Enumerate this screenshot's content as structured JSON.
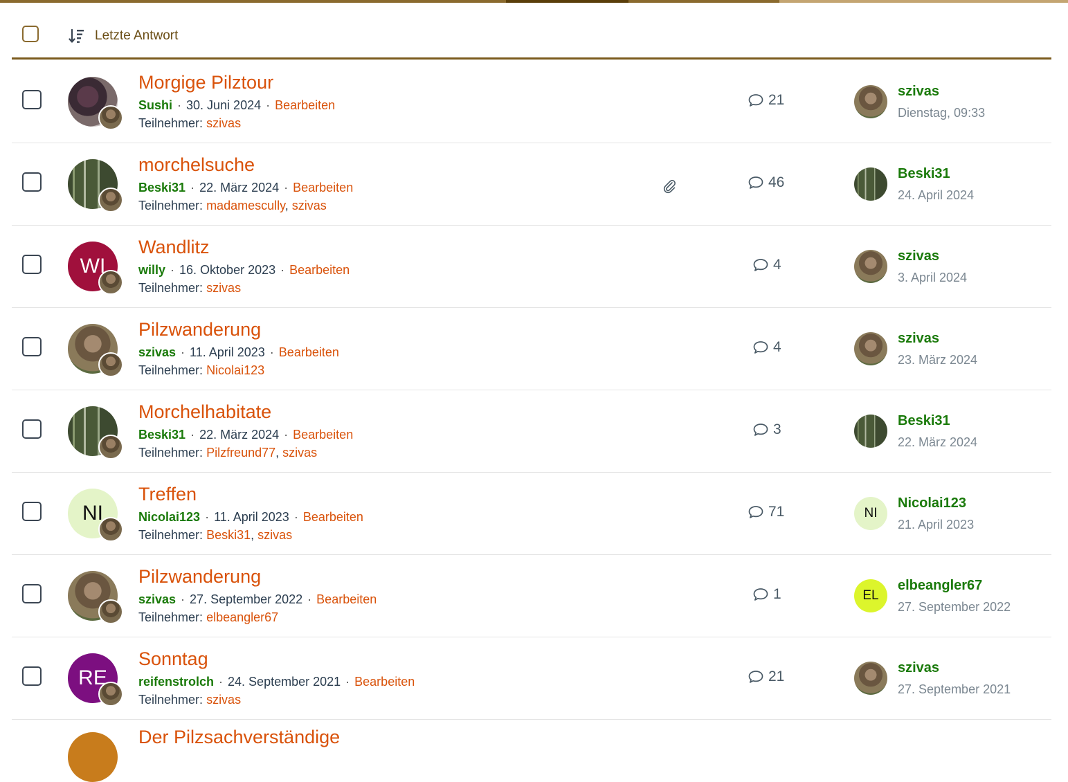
{
  "header": {
    "sort_label": "Letzte Antwort",
    "progress_colors": [
      "#8a6a2e",
      "#5a3e0a",
      "#8a6a2e",
      "#c4a572"
    ]
  },
  "rows": [
    {
      "title": "Morgige Pilztour",
      "author": "Sushi",
      "date": "30. Juni 2024",
      "edit_label": "Bearbeiten",
      "participants_label": "Teilnehmer:",
      "participants": [
        "szivas"
      ],
      "replies": "21",
      "attachment": false,
      "avatar_initials": "",
      "avatar_color": "",
      "last_poster": "szivas",
      "last_date": "Dienstag, 09:33",
      "last_avatar_initials": "",
      "last_avatar_color": ""
    },
    {
      "title": "morchelsuche",
      "author": "Beski31",
      "date": "22. März 2024",
      "edit_label": "Bearbeiten",
      "participants_label": "Teilnehmer:",
      "participants": [
        "madamescully",
        "szivas"
      ],
      "replies": "46",
      "attachment": true,
      "avatar_initials": "",
      "avatar_color": "",
      "last_poster": "Beski31",
      "last_date": "24. April 2024",
      "last_avatar_initials": "",
      "last_avatar_color": ""
    },
    {
      "title": "Wandlitz",
      "author": "willy",
      "date": "16. Oktober 2023",
      "edit_label": "Bearbeiten",
      "participants_label": "Teilnehmer:",
      "participants": [
        "szivas"
      ],
      "replies": "4",
      "attachment": false,
      "avatar_initials": "WI",
      "avatar_color": "#a0103c",
      "last_poster": "szivas",
      "last_date": "3. April 2024",
      "last_avatar_initials": "",
      "last_avatar_color": ""
    },
    {
      "title": "Pilzwanderung",
      "author": "szivas",
      "date": "11. April 2023",
      "edit_label": "Bearbeiten",
      "participants_label": "Teilnehmer:",
      "participants": [
        "Nicolai123"
      ],
      "replies": "4",
      "attachment": false,
      "avatar_initials": "",
      "avatar_color": "",
      "last_poster": "szivas",
      "last_date": "23. März 2024",
      "last_avatar_initials": "",
      "last_avatar_color": ""
    },
    {
      "title": "Morchelhabitate",
      "author": "Beski31",
      "date": "22. März 2024",
      "edit_label": "Bearbeiten",
      "participants_label": "Teilnehmer:",
      "participants": [
        "Pilzfreund77",
        "szivas"
      ],
      "replies": "3",
      "attachment": false,
      "avatar_initials": "",
      "avatar_color": "",
      "last_poster": "Beski31",
      "last_date": "22. März 2024",
      "last_avatar_initials": "",
      "last_avatar_color": ""
    },
    {
      "title": "Treffen",
      "author": "Nicolai123",
      "date": "11. April 2023",
      "edit_label": "Bearbeiten",
      "participants_label": "Teilnehmer:",
      "participants": [
        "Beski31",
        "szivas"
      ],
      "replies": "71",
      "attachment": false,
      "avatar_initials": "NI",
      "avatar_color": "#e4f4c8",
      "last_poster": "Nicolai123",
      "last_date": "21. April 2023",
      "last_avatar_initials": "NI",
      "last_avatar_color": "#e4f4c8"
    },
    {
      "title": "Pilzwanderung",
      "author": "szivas",
      "date": "27. September 2022",
      "edit_label": "Bearbeiten",
      "participants_label": "Teilnehmer:",
      "participants": [
        "elbeangler67"
      ],
      "replies": "1",
      "attachment": false,
      "avatar_initials": "",
      "avatar_color": "",
      "last_poster": "elbeangler67",
      "last_date": "27. September 2022",
      "last_avatar_initials": "EL",
      "last_avatar_color": "#dcf52c"
    },
    {
      "title": "Sonntag",
      "author": "reifenstrolch",
      "date": "24. September 2021",
      "edit_label": "Bearbeiten",
      "participants_label": "Teilnehmer:",
      "participants": [
        "szivas"
      ],
      "replies": "21",
      "attachment": false,
      "avatar_initials": "RE",
      "avatar_color": "#7c0f80",
      "last_poster": "szivas",
      "last_date": "27. September 2021",
      "last_avatar_initials": "",
      "last_avatar_color": ""
    }
  ],
  "partial_row": {
    "title": "Der Pilzsachverständige"
  },
  "colors": {
    "accent": "#d9520a",
    "author": "#1a7a0a",
    "header_rule": "#7a5a1c"
  },
  "icons": {
    "sort": "sort-descending-icon",
    "replies": "speech-bubble-icon",
    "attachment": "paperclip-icon"
  }
}
